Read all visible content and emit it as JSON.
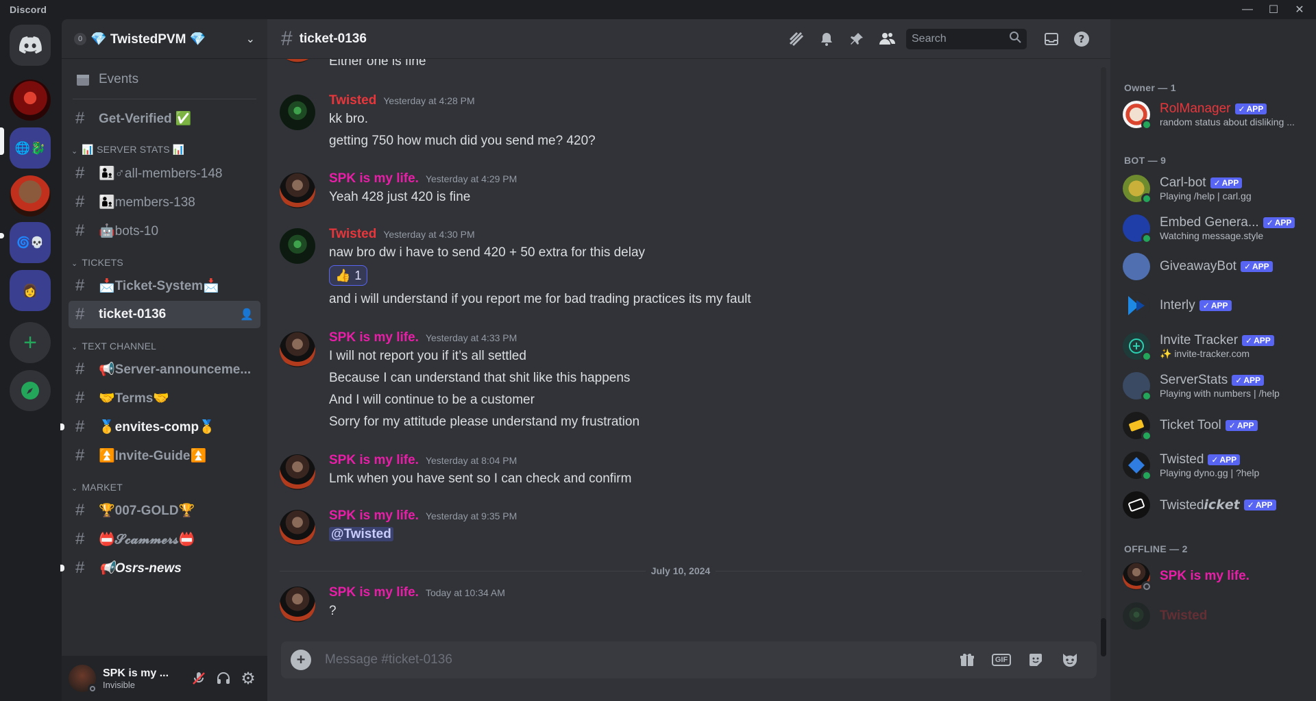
{
  "app": {
    "title": "Discord"
  },
  "colors": {
    "red_user": "#e8363b",
    "pink_user": "#e91ea8",
    "accent": "#5865f2"
  },
  "server": {
    "name": "💎 TwistedPVM 💎",
    "boost_count": "0"
  },
  "sidebar": {
    "events": "Events",
    "get_verified": "Get-Verified ✅",
    "cat_stats": "📊 SERVER STATS 📊",
    "all_members": "👨‍👦♂all-members-148",
    "members": "👨‍👦members-138",
    "bots": "🤖bots-10",
    "cat_tickets": "TICKETS",
    "ticket_system": "📩Ticket-System📩",
    "ticket_0136": "ticket-0136",
    "cat_text": "TEXT CHANNEL",
    "server_announce": "📢Server-announceme...",
    "terms": "🤝Terms🤝",
    "envites": "🥇envites-comp🥇",
    "invite_guide": "⏫Invite-Guide⏫",
    "cat_market": "MARKET",
    "gold": "🏆007-GOLD🏆",
    "scammers": "📛𝓢𝓬𝓪𝓶𝓶𝓮𝓻𝓼📛",
    "osrs_news": "📢Osrs-news"
  },
  "user": {
    "name": "SPK is my ...",
    "status": "Invisible"
  },
  "channel": {
    "title": "ticket-0136",
    "search_placeholder": "Search",
    "composer_placeholder": "Message #ticket-0136"
  },
  "messages": {
    "top_line": "Either one is fine",
    "m1": {
      "author": "Twisted",
      "time": "Yesterday at 4:28 PM",
      "lines": [
        "kk bro.",
        "getting 750 how much did you send me? 420?"
      ]
    },
    "m2": {
      "author": "SPK is my life.",
      "time": "Yesterday at 4:29 PM",
      "lines": [
        "Yeah 428 just 420 is fine"
      ]
    },
    "m3": {
      "author": "Twisted",
      "time": "Yesterday at 4:30 PM",
      "lines": [
        "naw bro dw i have to send 420 + 50 extra for this delay",
        "and i will understand if you report me for bad trading practices its my fault"
      ],
      "reaction_emoji": "👍",
      "reaction_count": "1"
    },
    "m4": {
      "author": "SPK is my life.",
      "time": "Yesterday at 4:33 PM",
      "lines": [
        "I will not report you if it’s all settled",
        "Because I can understand that shit like this happens",
        "And I will continue to be a customer",
        "Sorry for my attitude please understand my frustration"
      ]
    },
    "m5": {
      "author": "SPK is my life.",
      "time": "Yesterday at 8:04 PM",
      "lines": [
        "Lmk when you have sent so I can check and confirm"
      ]
    },
    "m6": {
      "author": "SPK is my life.",
      "time": "Yesterday at 9:35 PM",
      "mention": "@Twisted"
    },
    "date_sep": "July 10, 2024",
    "m7": {
      "author": "SPK is my life.",
      "time": "Today at 10:34 AM",
      "lines": [
        "?"
      ]
    }
  },
  "members": {
    "owner_header": "Owner — 1",
    "bot_header": "BOT — 9",
    "offline_header": "OFFLINE — 2",
    "app_tag": "APP",
    "list": [
      {
        "name": "RolManager",
        "sub": "random status about disliking ..."
      },
      {
        "name": "Carl-bot",
        "sub": "Playing /help | carl.gg"
      },
      {
        "name": "Embed Genera...",
        "sub": "Watching message.style"
      },
      {
        "name": "GiveawayBot",
        "sub": ""
      },
      {
        "name": "Interly",
        "sub": ""
      },
      {
        "name": "Invite Tracker",
        "sub": "✨ invite-tracker.com"
      },
      {
        "name": "ServerStats",
        "sub": "Playing with numbers | /help"
      },
      {
        "name": "Ticket Tool",
        "sub": ""
      },
      {
        "name": "Twisted",
        "sub": "Playing dyno.gg | ?help"
      },
      {
        "name": "Twisted𝙞𝙘𝙠𝙚𝙩",
        "sub": ""
      },
      {
        "name": "SPK is my life.",
        "sub": ""
      },
      {
        "name": "Twisted",
        "sub": ""
      }
    ]
  }
}
